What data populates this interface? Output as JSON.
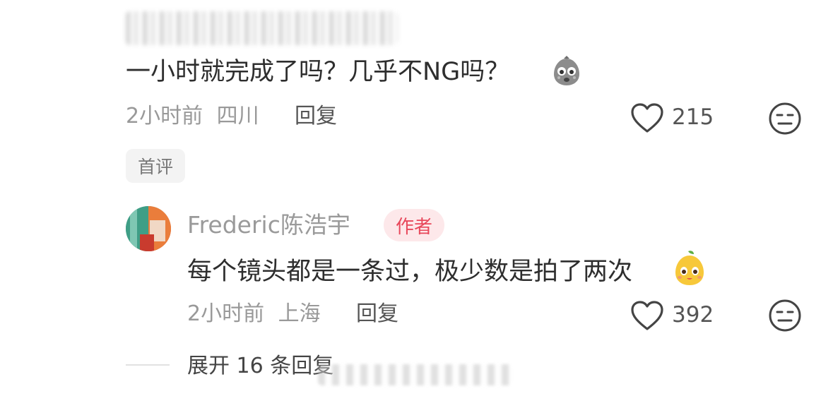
{
  "comment1": {
    "text": "一小时就完成了吗？几乎不NG吗？",
    "emoji_icon": "shocked-face-emoji",
    "time": "2小时前",
    "location": "四川",
    "reply_label": "回复",
    "like_count": "215",
    "badge": "首评"
  },
  "reply1": {
    "author_name": "Frederic陈浩宇",
    "author_badge": "作者",
    "text": "每个镜头都是一条过，极少数是拍了两次",
    "emoji_icon": "cute-pear-emoji",
    "time": "2小时前",
    "location": "上海",
    "reply_label": "回复",
    "like_count": "392"
  },
  "footer": {
    "expand_label": "展开 16 条回复"
  },
  "colors": {
    "accent_red": "#e8485b",
    "meta_gray": "#999999",
    "text_dark": "#2e2e2e"
  }
}
